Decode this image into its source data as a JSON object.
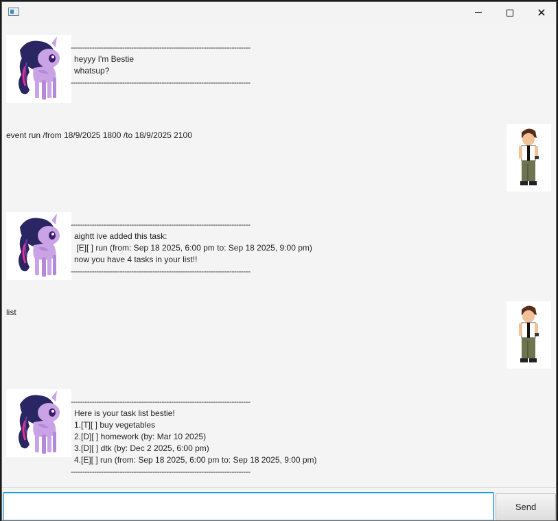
{
  "window": {
    "title": "",
    "controls": {
      "minimize": "minimize-icon",
      "maximize": "maximize-icon",
      "close": "close-icon"
    }
  },
  "separator": "-----------------------------------------------------------------------------",
  "messages": [
    {
      "sender": "bot",
      "avatar": "twilight-sparkle-avatar",
      "lines": [
        "heyyy I'm Bestie",
        "whatsup?"
      ]
    },
    {
      "sender": "user",
      "avatar": "ben10-avatar",
      "text": "event run /from 18/9/2025 1800 /to 18/9/2025 2100"
    },
    {
      "sender": "bot",
      "avatar": "twilight-sparkle-avatar",
      "lines": [
        "aightt ive added this task:",
        " [E][ ] run (from: Sep 18 2025, 6:00 pm to: Sep 18 2025, 9:00 pm)",
        "now you have 4 tasks in your list!!"
      ]
    },
    {
      "sender": "user",
      "avatar": "ben10-avatar",
      "text": "list"
    },
    {
      "sender": "bot",
      "avatar": "twilight-sparkle-avatar",
      "lines": [
        "Here is your task list bestie!",
        "1.[T][ ] buy vegetables",
        "2.[D][ ] homework (by: Mar 10 2025)",
        "3.[D][ ] dtk (by: Dec 2 2025, 6:00 pm)",
        "4.[E][ ] run (from: Sep 18 2025, 6:00 pm to: Sep 18 2025, 9:00 pm)"
      ]
    }
  ],
  "composer": {
    "input_value": "",
    "placeholder": "",
    "send_label": "Send"
  },
  "colors": {
    "input_focus": "#1b9ad8",
    "background": "#f4f4f4"
  }
}
